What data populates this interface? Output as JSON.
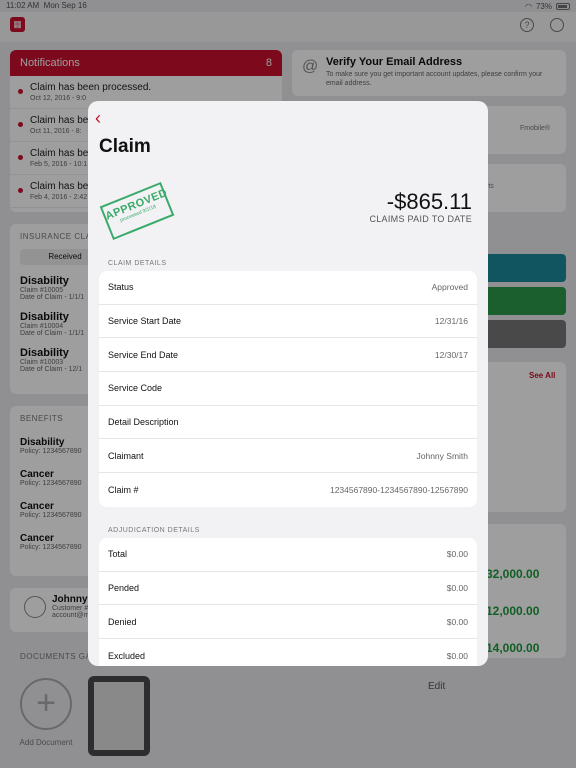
{
  "status_bar": {
    "time": "11:02 AM",
    "date": "Mon Sep 16",
    "battery": "73%"
  },
  "notifications": {
    "title": "Notifications",
    "count": "8",
    "items": [
      {
        "text": "Claim has been processed.",
        "date": "Oct 12, 2016 - 9:0"
      },
      {
        "text": "Claim has bee",
        "date": "Oct 11, 2016 - 8:"
      },
      {
        "text": "Claim has bee",
        "date": "Feb 5, 2016 - 10:1"
      },
      {
        "text": "Claim has bee",
        "date": "Feb 4, 2016 - 2:42"
      }
    ]
  },
  "verify": {
    "title": "Verify Your Email Address",
    "subtitle": "To make sure you get important account updates, please confirm your email address."
  },
  "right_column": {
    "mobile_text": "Fmobile®",
    "rts_text": "rts",
    "see_all": "See All",
    "amounts": [
      "32,000.00",
      "12,000.00",
      "14,000.00"
    ],
    "edit": "Edit"
  },
  "insurance_claims": {
    "label": "INSURANCE CLA",
    "tab": "Received",
    "items": [
      {
        "title": "Disability",
        "line1": "Claim #10005",
        "line2": "Date of Claim - 1/1/1"
      },
      {
        "title": "Disability",
        "line1": "Claim #10004",
        "line2": "Date of Claim - 1/1/1"
      },
      {
        "title": "Disability",
        "line1": "Claim #10003",
        "line2": "Date of Claim - 12/1"
      }
    ]
  },
  "benefits": {
    "label": "BENEFITS",
    "items": [
      {
        "title": "Disability",
        "policy": "Policy: 1234567890"
      },
      {
        "title": "Cancer",
        "policy": "Policy: 1234567890"
      },
      {
        "title": "Cancer",
        "policy": "Policy: 1234567890"
      },
      {
        "title": "Cancer",
        "policy": "Policy: 1234567890"
      }
    ]
  },
  "user": {
    "name": "Johnny Sr",
    "line1": "Customer #1",
    "line2": "account@ma"
  },
  "documents": {
    "label": "DOCUMENTS GA",
    "add_label": "Add Document"
  },
  "modal": {
    "title": "Claim",
    "stamp": {
      "text": "APPROVED",
      "sub": "processed 9/1/18"
    },
    "amount": "-$865.11",
    "amount_caption": "CLAIMS PAID TO DATE",
    "claim_details_label": "CLAIM DETAILS",
    "claim_details": [
      {
        "label": "Status",
        "value": "Approved"
      },
      {
        "label": "Service Start Date",
        "value": "12/31/16"
      },
      {
        "label": "Service End Date",
        "value": "12/30/17"
      },
      {
        "label": "Service Code",
        "value": ""
      },
      {
        "label": "Detail Description",
        "value": ""
      },
      {
        "label": "Claimant",
        "value": "Johnny Smith"
      },
      {
        "label": "Claim #",
        "value": "1234567890-1234567890-12567890"
      }
    ],
    "adjudication_label": "ADJUDICATION DETAILS",
    "adjudication": [
      {
        "label": "Total",
        "value": "$0.00"
      },
      {
        "label": "Pended",
        "value": "$0.00"
      },
      {
        "label": "Denied",
        "value": "$0.00"
      },
      {
        "label": "Excluded",
        "value": "$0.00"
      }
    ]
  }
}
